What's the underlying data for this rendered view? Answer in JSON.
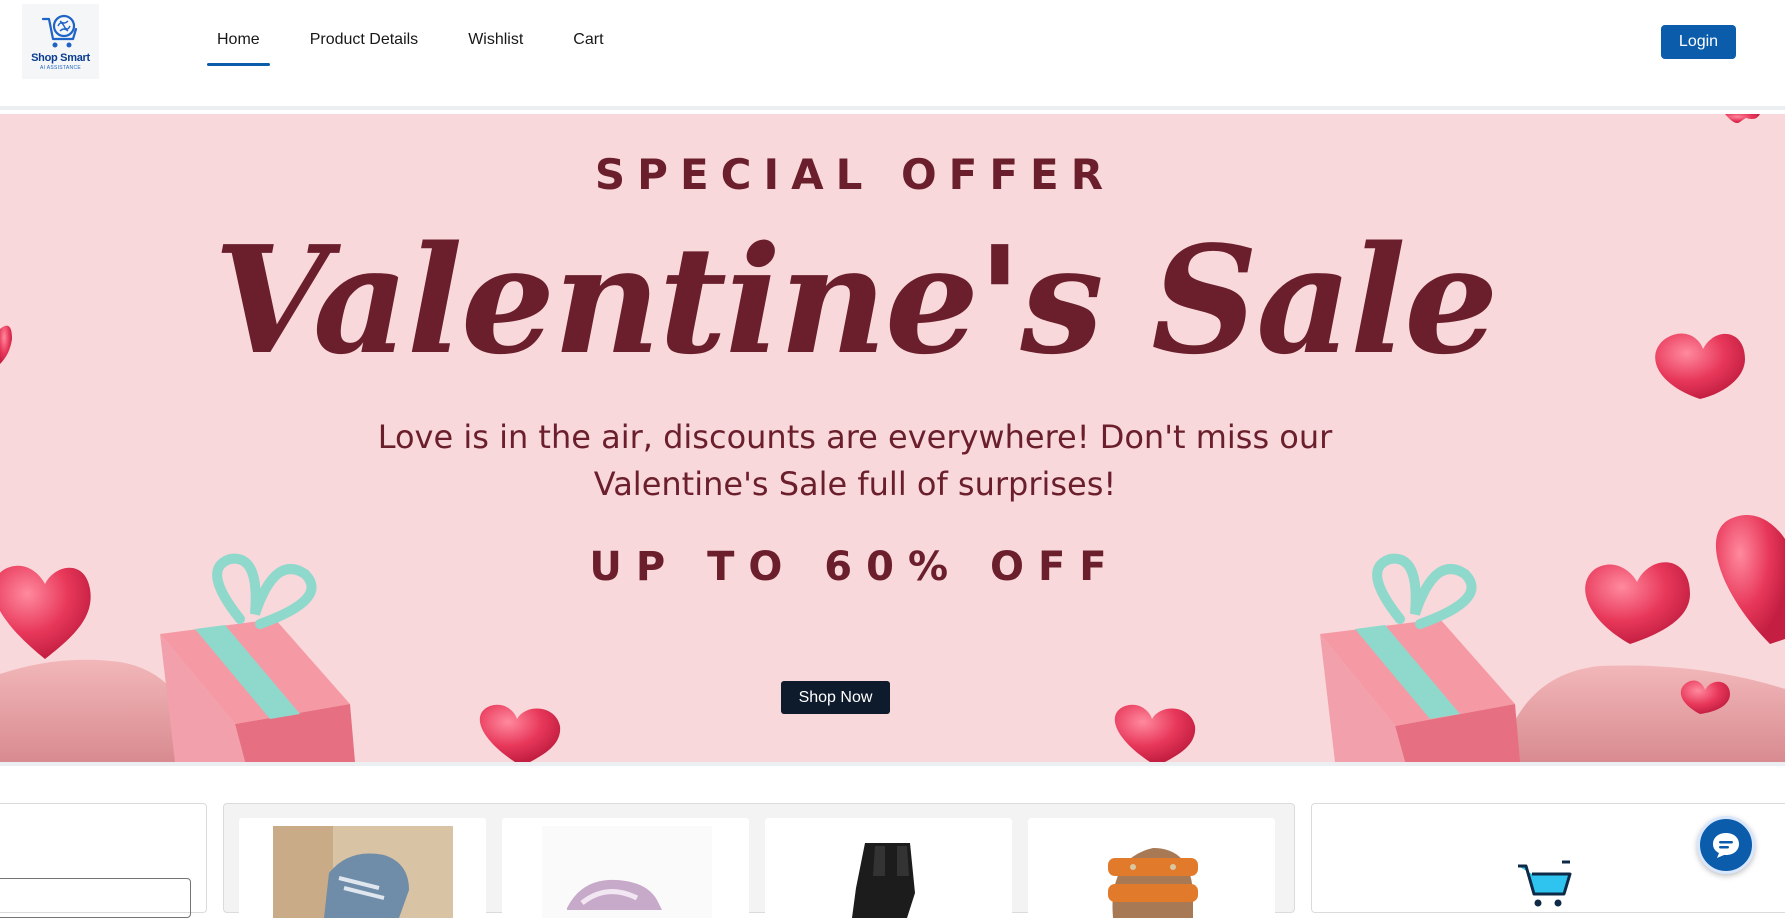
{
  "brand": {
    "name": "Shop Smart",
    "tagline": "AI ASSISTANCE",
    "logo_icon": "cart-brain-icon",
    "primary_color": "#0b5cab"
  },
  "nav": {
    "items": [
      {
        "label": "Home",
        "active": true
      },
      {
        "label": "Product Details",
        "active": false
      },
      {
        "label": "Wishlist",
        "active": false
      },
      {
        "label": "Cart",
        "active": false
      }
    ]
  },
  "header": {
    "login_label": "Login"
  },
  "hero": {
    "eyebrow": "SPECIAL OFFER",
    "title": "Valentine's Sale",
    "text": "Love is in the air, discounts are everywhere! Don't miss our Valentine's Sale full of surprises!",
    "discount": "UP TO 60% OFF",
    "cta_label": "Shop Now",
    "background_color": "#f8d8da",
    "text_color": "#6b1f2c"
  },
  "products": {
    "items": [
      {
        "image": "blue-sandal-shoe"
      },
      {
        "image": "pink-sneaker-shoe"
      },
      {
        "image": "black-ankle-boot"
      },
      {
        "image": "orange-strap-sandal"
      }
    ]
  },
  "sidebar_right": {
    "icon": "shopping-cart-icon"
  },
  "chat": {
    "icon": "chat-bubble-icon"
  }
}
